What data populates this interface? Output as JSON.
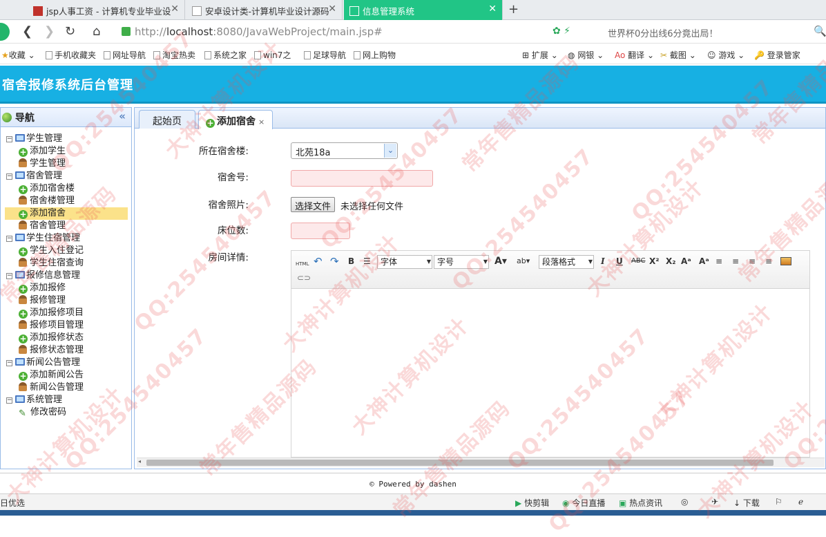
{
  "browser": {
    "tabs": [
      {
        "title": "jsp人事工资 - 计算机专业毕业设",
        "active": false
      },
      {
        "title": "安卓设计类-计算机毕业设计源码",
        "active": false
      },
      {
        "title": "信息管理系统",
        "active": true
      }
    ],
    "new_tab": "+",
    "url_protocol": "http://",
    "url_host": "localhost",
    "url_rest": ":8080/JavaWebProject/main.jsp#",
    "news": "世界杯0分出线6分竟出局！",
    "bookmarks": [
      "收藏",
      "手机收藏夹",
      "网址导航",
      "淘宝热卖",
      "系统之家",
      "win7之",
      "足球导航",
      "网上购物"
    ],
    "right_tools": [
      "扩展",
      "网银",
      "翻译",
      "截图",
      "游戏",
      "登录管家"
    ]
  },
  "app": {
    "title": "宿舍报修系统后台管理"
  },
  "sidebar": {
    "title": "导航",
    "groups": [
      {
        "label": "学生管理",
        "items": [
          {
            "label": "添加学生",
            "icon": "add"
          },
          {
            "label": "学生管理",
            "icon": "user"
          }
        ]
      },
      {
        "label": "宿舍管理",
        "items": [
          {
            "label": "添加宿舍楼",
            "icon": "add"
          },
          {
            "label": "宿舍楼管理",
            "icon": "user"
          },
          {
            "label": "添加宿舍",
            "icon": "add",
            "selected": true
          },
          {
            "label": "宿舍管理",
            "icon": "user"
          }
        ]
      },
      {
        "label": "学生住宿管理",
        "items": [
          {
            "label": "学生入住登记",
            "icon": "add"
          },
          {
            "label": "学生住宿查询",
            "icon": "user"
          }
        ]
      },
      {
        "label": "报修信息管理",
        "items": [
          {
            "label": "添加报修",
            "icon": "add"
          },
          {
            "label": "报修管理",
            "icon": "user"
          },
          {
            "label": "添加报修项目",
            "icon": "add"
          },
          {
            "label": "报修项目管理",
            "icon": "user"
          },
          {
            "label": "添加报修状态",
            "icon": "add"
          },
          {
            "label": "报修状态管理",
            "icon": "user"
          }
        ]
      },
      {
        "label": "新闻公告管理",
        "items": [
          {
            "label": "添加新闻公告",
            "icon": "add"
          },
          {
            "label": "新闻公告管理",
            "icon": "user"
          }
        ]
      },
      {
        "label": "系统管理",
        "items": [
          {
            "label": "修改密码",
            "icon": "pen"
          }
        ]
      }
    ]
  },
  "content_tabs": [
    {
      "label": "起始页"
    },
    {
      "label": "添加宿舍",
      "closable": true
    }
  ],
  "form": {
    "building_label": "所在宿舍楼:",
    "building_value": "北苑18a",
    "room_label": "宿舍号:",
    "photo_label": "宿舍照片:",
    "photo_button": "选择文件",
    "photo_status": "未选择任何文件",
    "beds_label": "床位数:",
    "detail_label": "房间详情:"
  },
  "editor": {
    "font_combo": "字体",
    "size_combo": "字号",
    "format_combo": "段落格式",
    "html_btn": "HTML"
  },
  "footer": "© Powered by dashen",
  "statusbar": {
    "left": "日优选",
    "items": [
      "快剪辑",
      "今日直播",
      "热点资讯",
      "下载"
    ]
  },
  "watermarks": [
    "QQ:254540457",
    "大神计算机设计",
    "常年售精品源码"
  ]
}
